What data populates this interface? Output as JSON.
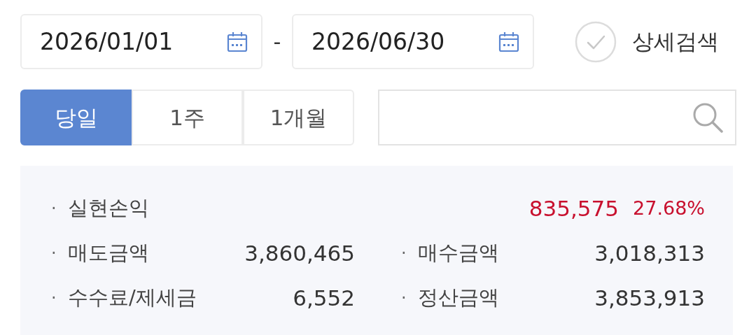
{
  "date_range": {
    "start": "2026/01/01",
    "separator": "-",
    "end": "2026/06/30"
  },
  "detail_search": {
    "label": "상세검색",
    "checked": false
  },
  "period_tabs": [
    {
      "label": "당일",
      "selected": true
    },
    {
      "label": "1주",
      "selected": false
    },
    {
      "label": "1개월",
      "selected": false
    }
  ],
  "summary": {
    "headline": {
      "bullet": "·",
      "label": "실현손익",
      "amount": "835,575",
      "rate": "27.68%"
    },
    "items": [
      {
        "bullet": "·",
        "label": "매도금액",
        "value": "3,860,465"
      },
      {
        "bullet": "·",
        "label": "매수금액",
        "value": "3,018,313"
      },
      {
        "bullet": "·",
        "label": "수수료/제세금",
        "value": "6,552"
      },
      {
        "bullet": "·",
        "label": "정산금액",
        "value": "3,853,913"
      }
    ]
  }
}
